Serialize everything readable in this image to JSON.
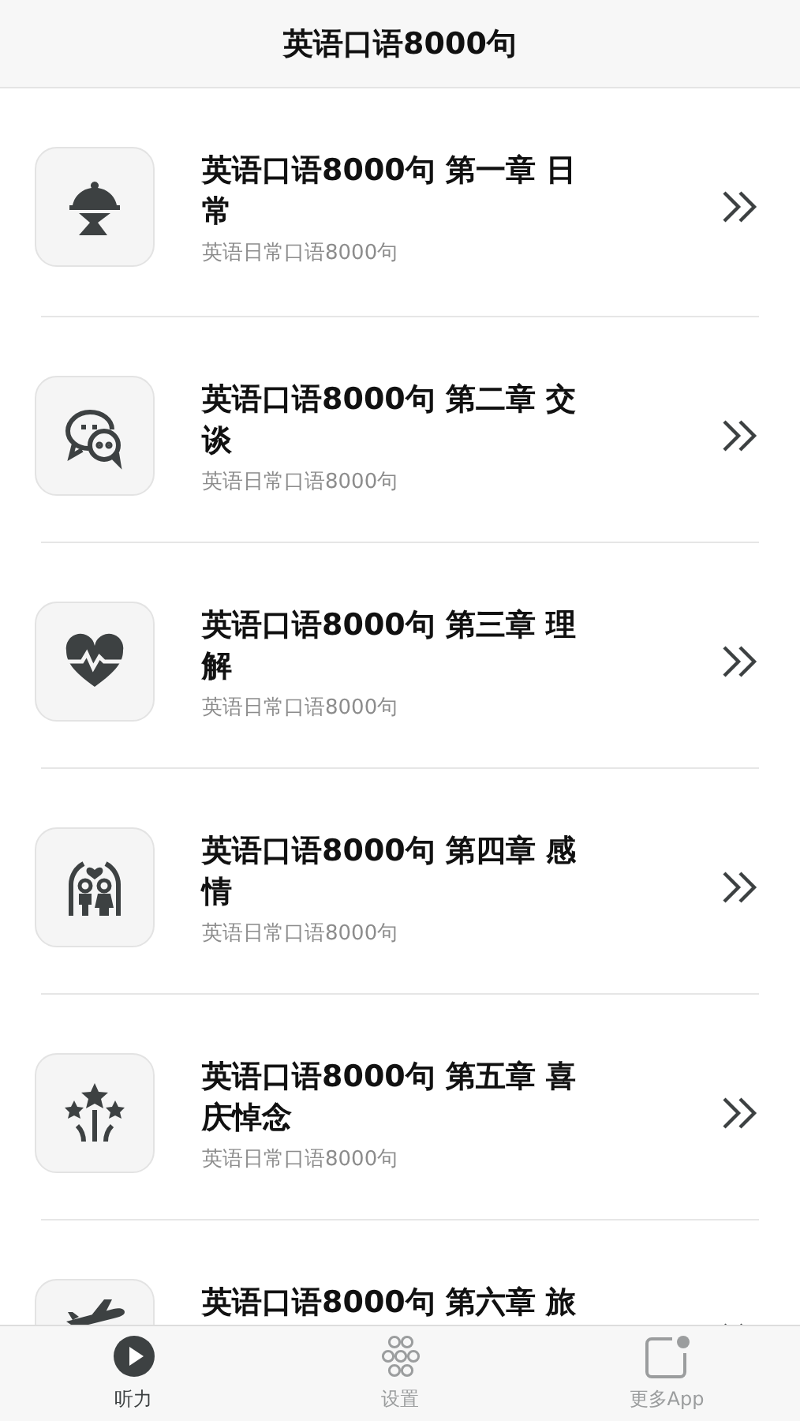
{
  "header": {
    "title": "英语口语8000句"
  },
  "chapters": [
    {
      "kind": "cloche",
      "title": "英语口语8000句 第一章 日常",
      "subtitle": "英语日常口语8000句"
    },
    {
      "kind": "chat",
      "title": "英语口语8000句 第二章 交谈",
      "subtitle": "英语日常口语8000句"
    },
    {
      "kind": "heart",
      "title": "英语口语8000句 第三章 理解",
      "subtitle": "英语日常口语8000句"
    },
    {
      "kind": "couple",
      "title": "英语口语8000句 第四章 感情",
      "subtitle": "英语日常口语8000句"
    },
    {
      "kind": "stars",
      "title": "英语口语8000句 第五章 喜庆悼念",
      "subtitle": "英语日常口语8000句"
    },
    {
      "kind": "plane",
      "title": "英语口语8000句 第六章 旅"
    }
  ],
  "tab_bar": [
    {
      "kind": "play",
      "label": "听力",
      "selected": true
    },
    {
      "kind": "flower",
      "label": "设置",
      "selected": false
    },
    {
      "kind": "app",
      "label": "更多App",
      "selected": false
    }
  ]
}
